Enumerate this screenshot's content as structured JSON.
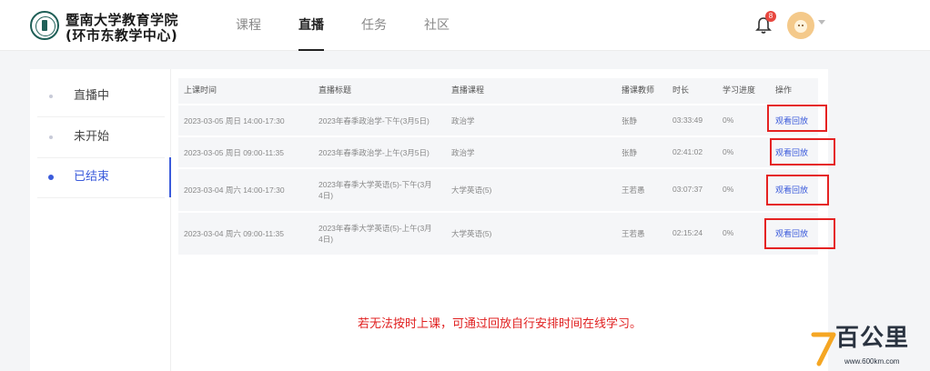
{
  "header": {
    "logo_line1": "暨南大学教育学院",
    "logo_line2": "(环市东教学中心)",
    "nav": [
      "课程",
      "直播",
      "任务",
      "社区"
    ],
    "active_nav": "直播",
    "notification_count": "8"
  },
  "sidebar": {
    "items": [
      {
        "label": "直播中"
      },
      {
        "label": "未开始"
      },
      {
        "label": "已结束"
      }
    ],
    "active": "已结束"
  },
  "table": {
    "columns": [
      "上课时间",
      "直播标题",
      "直播课程",
      "播课教师",
      "时长",
      "学习进度",
      "操作"
    ],
    "rows": [
      {
        "time": "2023-03-05   周日   14:00-17:30",
        "title": "2023年春季政治学-下午(3月5日)",
        "course": "政治学",
        "teacher": "张静",
        "duration": "03:33:49",
        "progress": "0%",
        "action": "观看回放"
      },
      {
        "time": "2023-03-05   周日   09:00-11:35",
        "title": "2023年春季政治学-上午(3月5日)",
        "course": "政治学",
        "teacher": "张静",
        "duration": "02:41:02",
        "progress": "0%",
        "action": "观看回放"
      },
      {
        "time": "2023-03-04   周六   14:00-17:30",
        "title": "2023年春季大学英语(5)-下午(3月4日)",
        "course": "大学英语(5)",
        "teacher": "王若愚",
        "duration": "03:07:37",
        "progress": "0%",
        "action": "观看回放"
      },
      {
        "time": "2023-03-04   周六   09:00-11:35",
        "title": "2023年春季大学英语(5)-上午(3月4日)",
        "course": "大学英语(5)",
        "teacher": "王若愚",
        "duration": "02:15:24",
        "progress": "0%",
        "action": "观看回放"
      }
    ]
  },
  "notice": "若无法按时上课，可通过回放自行安排时间在线学习。",
  "watermark": {
    "text": "百公里",
    "url": "www.600km.com"
  },
  "colors": {
    "accent": "#3b5bdb",
    "highlight_box": "#e52222",
    "notice": "#e02020"
  },
  "icons": [
    "bell-icon",
    "avatar",
    "chevron-down-icon",
    "logo-seal"
  ]
}
